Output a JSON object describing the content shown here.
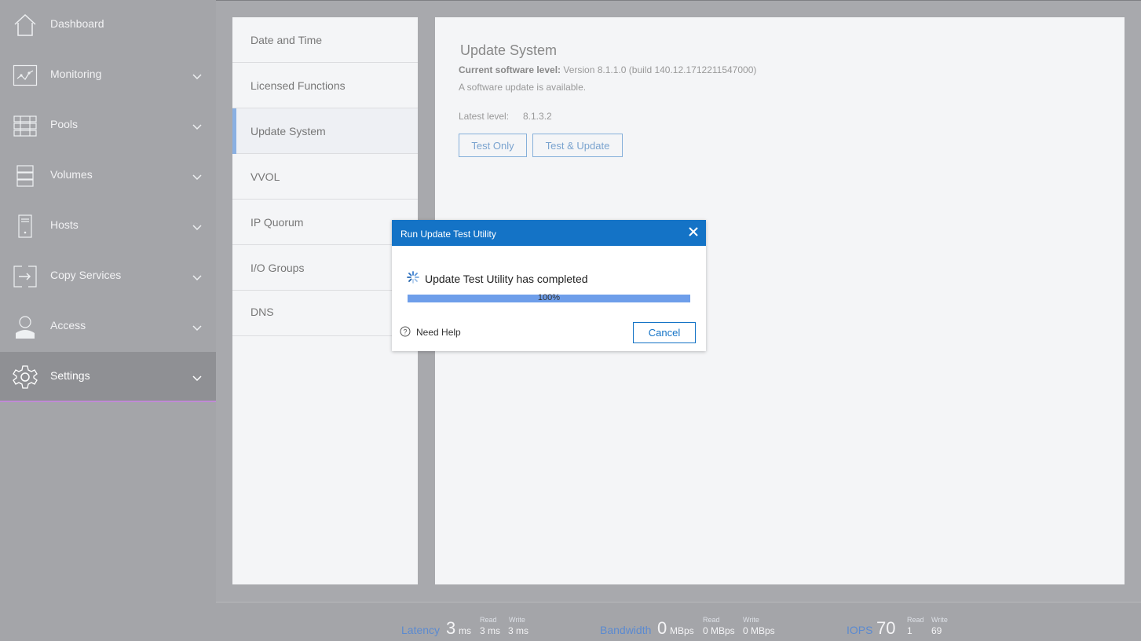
{
  "sidebar": {
    "items": [
      {
        "label": "Dashboard",
        "icon": "home-icon"
      },
      {
        "label": "Monitoring",
        "icon": "monitoring-icon"
      },
      {
        "label": "Pools",
        "icon": "pools-icon"
      },
      {
        "label": "Volumes",
        "icon": "volumes-icon"
      },
      {
        "label": "Hosts",
        "icon": "hosts-icon"
      },
      {
        "label": "Copy Services",
        "icon": "copy-services-icon"
      },
      {
        "label": "Access",
        "icon": "user-icon"
      },
      {
        "label": "Settings",
        "icon": "gear-icon",
        "active": true
      }
    ]
  },
  "settings_nav": {
    "items": [
      {
        "label": "Date and Time"
      },
      {
        "label": "Licensed Functions"
      },
      {
        "label": "Update System",
        "active": true
      },
      {
        "label": "VVOL"
      },
      {
        "label": "IP Quorum"
      },
      {
        "label": "I/O Groups"
      },
      {
        "label": "DNS"
      }
    ]
  },
  "content": {
    "title": "Update System",
    "current_level_label": "Current software level:",
    "current_level_value": " Version 8.1.1.0 (build 140.12.1712211547000)",
    "update_available": "A software update is available.",
    "latest_level_label": "Latest level:",
    "latest_level_value": "8.1.3.2",
    "test_only_label": "Test Only",
    "test_update_label": "Test & Update"
  },
  "dialog": {
    "title": "Run Update Test Utility",
    "status": "Update Test Utility has completed",
    "progress_text": "100%",
    "progress_fraction": 1.0,
    "help_label": "Need Help",
    "cancel_label": "Cancel"
  },
  "footer": {
    "latency": {
      "label": "Latency",
      "value": "3",
      "unit": "ms",
      "read_label": "Read",
      "read_value": "3 ms",
      "write_label": "Write",
      "write_value": "3 ms"
    },
    "bandwidth": {
      "label": "Bandwidth",
      "value": "0",
      "unit": "MBps",
      "read_label": "Read",
      "read_value": "0 MBps",
      "write_label": "Write",
      "write_value": "0 MBps"
    },
    "iops": {
      "label": "IOPS",
      "value": "70",
      "read_label": "Read",
      "read_value": "1",
      "write_label": "Write",
      "write_value": "69"
    }
  },
  "colors": {
    "accent": "#1473c6",
    "sidebar_bg": "#a4a5a9",
    "active_marker": "#c08ad6",
    "progress_fill": "#6e9eea"
  }
}
